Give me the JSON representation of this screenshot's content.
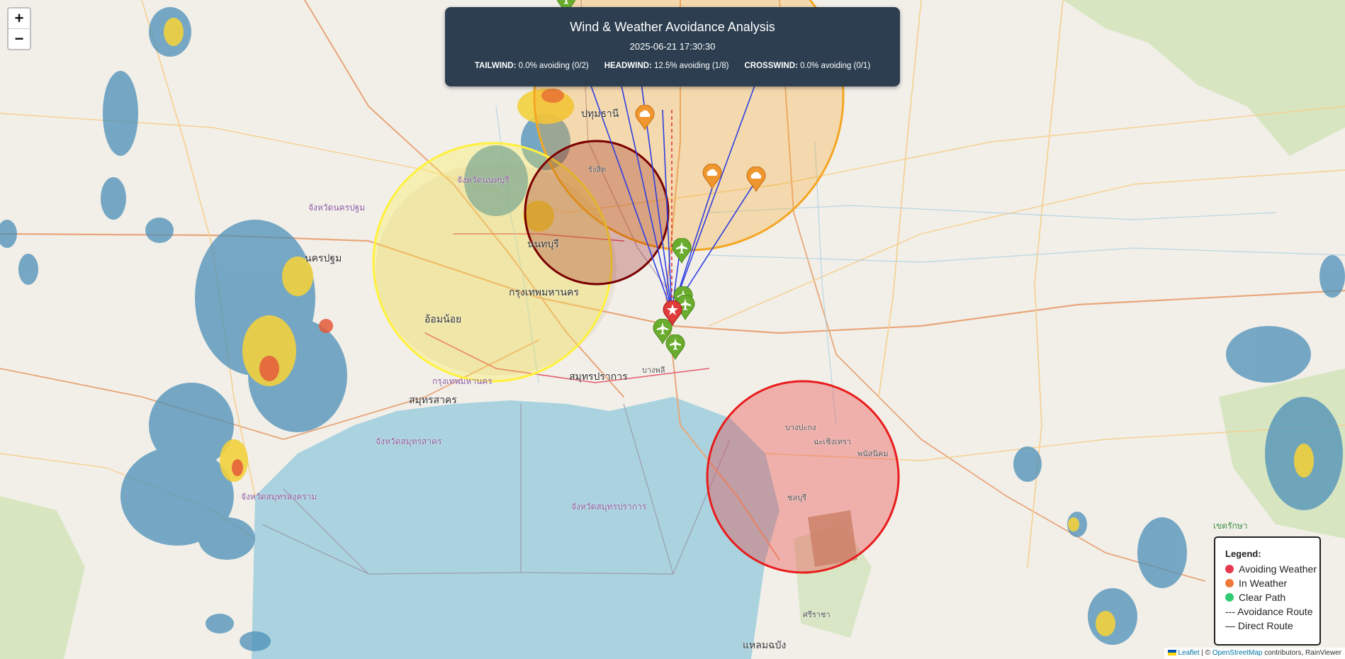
{
  "panel": {
    "title": "Wind & Weather Avoidance Analysis",
    "timestamp": "2025-06-21 17:30:30",
    "stats": [
      {
        "label": "TAILWIND:",
        "value": "0.0% avoiding (0/2)"
      },
      {
        "label": "HEADWIND:",
        "value": "12.5% avoiding (1/8)"
      },
      {
        "label": "CROSSWIND:",
        "value": "0.0% avoiding (0/1)"
      }
    ]
  },
  "zoom": {
    "in": "+",
    "out": "−"
  },
  "legend": {
    "title": "Legend:",
    "items": [
      {
        "label": "Avoiding Weather",
        "color": "#e63950"
      },
      {
        "label": "In Weather",
        "color": "#f07a3a"
      },
      {
        "label": "Clear Path",
        "color": "#2ecc71"
      }
    ],
    "lines": [
      "--- Avoidance Route",
      "— Direct Route"
    ]
  },
  "attribution": {
    "leaflet": "Leaflet",
    "sep": " | © ",
    "osm": "OpenStreetMap",
    "rest": " contributors, RainViewer"
  },
  "colors": {
    "sea": "#aad3df",
    "land": "#f2efe9",
    "airport": "#e03a3a",
    "aircraft": "#6aad2e",
    "weather_marker": "#f0962e"
  },
  "places": {
    "bangkok": "กรุงเทพมหานคร",
    "samut_prakan": "สมุทรปราการ",
    "samut_sakhon": "สมุทรสาคร",
    "nonthaburi": "นนทบุรี",
    "nakhon_pathom": "นครปฐม",
    "pathum_thani": "ปทุมธานี",
    "chonburi": "ชลบุรี",
    "si_racha": "ศรีราชา",
    "chachoengsao": "ฉะเชิงเทรา",
    "phanat_nikhom": "พนัสนิคม",
    "bang_pakong": "บางปะกง",
    "chang_wat_samut_sakhon": "จังหวัดสมุทรสาคร",
    "chang_wat_samut_prakan": "จังหวัดสมุทรปราการ",
    "chang_wat_samut_songkhram": "จังหวัดสมุทรสงคราม",
    "chang_wat_nakhon_pathom": "จังหวัดนครปฐม",
    "chang_wat_nonthaburi": "จังหวัดนนทบุรี",
    "krung_thep": "กรุงเทพมหานคร",
    "rangsit": "รังสิต",
    "bang_phli": "บางพลี",
    "om_noi": "อ้อมน้อย",
    "khet_raksa": "เขตรักษา",
    "laem_chabang": "แหลมฉบัง"
  }
}
